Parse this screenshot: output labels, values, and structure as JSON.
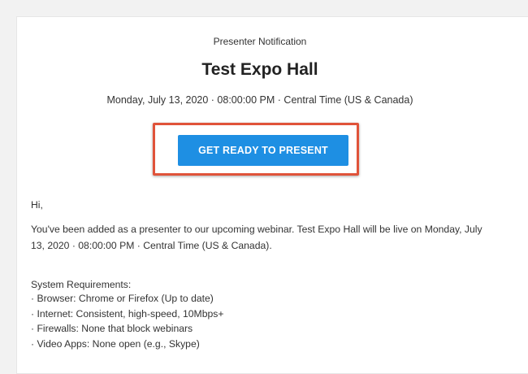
{
  "notification": {
    "header_label": "Presenter Notification",
    "event_title": "Test Expo Hall",
    "event_datetime": "Monday, July 13, 2020 · 08:00:00 PM · Central Time (US & Canada)"
  },
  "cta": {
    "label": "GET READY TO PRESENT",
    "color": "#1e8fe3",
    "highlight_color": "#e0533a"
  },
  "body": {
    "greeting": "Hi,",
    "message": "You've been added as a presenter to our upcoming webinar. Test Expo Hall will be live on Monday, July 13, 2020 · 08:00:00 PM · Central Time (US & Canada).",
    "requirements_title": "System Requirements:",
    "requirements": [
      "Browser: Chrome or Firefox (Up to date)",
      "Internet: Consistent, high-speed, 10Mbps+",
      "Firewalls: None that block webinars",
      "Video Apps: None open (e.g., Skype)"
    ]
  }
}
